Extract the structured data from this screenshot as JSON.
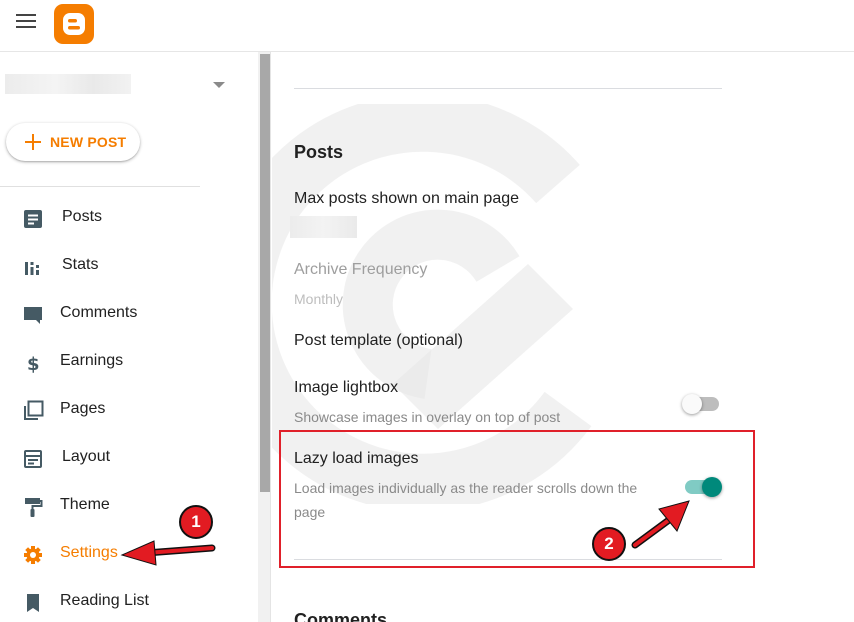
{
  "app": {
    "menu_icon": "hamburger-menu-icon",
    "logo_icon": "blogger-logo-icon",
    "brand_color": "#f57d00"
  },
  "sidebar": {
    "new_post_label": "NEW POST",
    "items": [
      {
        "label": "Posts",
        "icon": "posts-icon"
      },
      {
        "label": "Stats",
        "icon": "stats-icon"
      },
      {
        "label": "Comments",
        "icon": "comments-icon"
      },
      {
        "label": "Earnings",
        "icon": "dollar-icon"
      },
      {
        "label": "Pages",
        "icon": "pages-icon"
      },
      {
        "label": "Layout",
        "icon": "layout-icon"
      },
      {
        "label": "Theme",
        "icon": "paint-roller-icon"
      },
      {
        "label": "Settings",
        "icon": "gear-icon",
        "active": true
      },
      {
        "label": "Reading List",
        "icon": "bookmark-icon"
      }
    ]
  },
  "main": {
    "section_title": "Posts",
    "max_posts_label": "Max posts shown on main page",
    "archive_label": "Archive Frequency",
    "archive_value": "Monthly",
    "template_label": "Post template (optional)",
    "lightbox_label": "Image lightbox",
    "lightbox_desc": "Showcase images in overlay on top of post",
    "lightbox_enabled": false,
    "lazy_label": "Lazy load images",
    "lazy_desc": "Load images individually as the reader scrolls down the page",
    "lazy_enabled": true,
    "next_section_title": "Comments"
  },
  "annotations": {
    "badge_1": "1",
    "badge_2": "2",
    "highlight_color": "#e0202a"
  }
}
